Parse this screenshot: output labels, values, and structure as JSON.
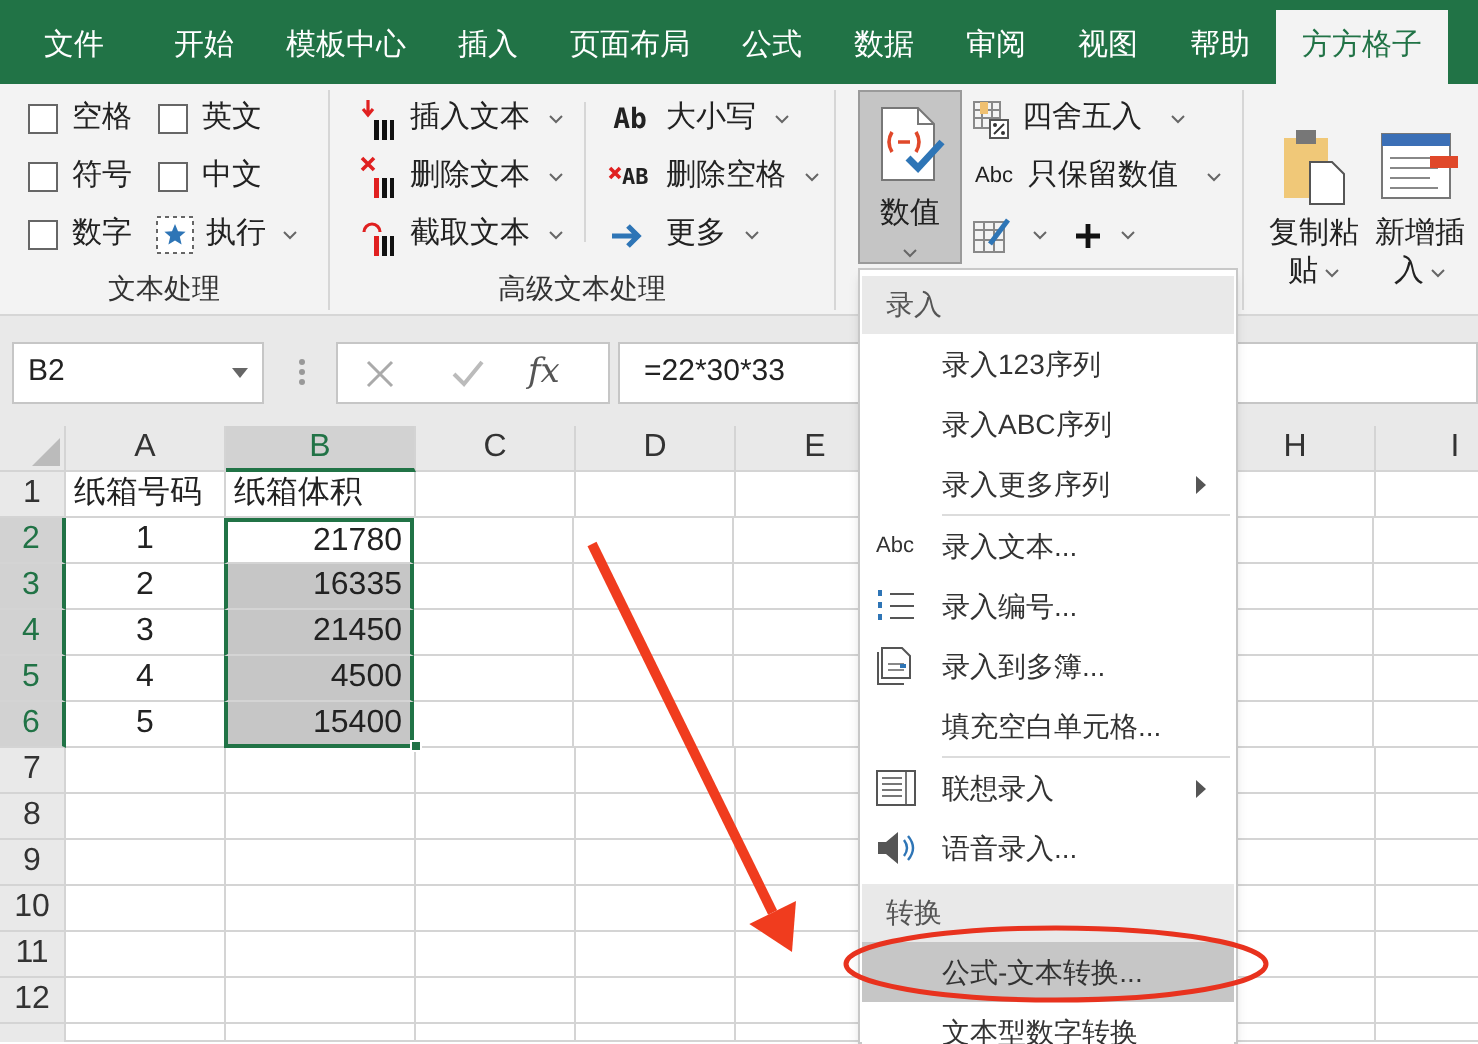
{
  "tabs": [
    {
      "label": "文件",
      "selected": false
    },
    {
      "label": "开始",
      "selected": false
    },
    {
      "label": "模板中心",
      "selected": false
    },
    {
      "label": "插入",
      "selected": false
    },
    {
      "label": "页面布局",
      "selected": false
    },
    {
      "label": "公式",
      "selected": false
    },
    {
      "label": "数据",
      "selected": false
    },
    {
      "label": "审阅",
      "selected": false
    },
    {
      "label": "视图",
      "selected": false
    },
    {
      "label": "帮助",
      "selected": false
    },
    {
      "label": "方方格子",
      "selected": true
    }
  ],
  "ribbon": {
    "text_group": {
      "label": "文本处理",
      "checkboxes": [
        {
          "label": "空格",
          "checked": false
        },
        {
          "label": "英文",
          "checked": false
        },
        {
          "label": "符号",
          "checked": false
        },
        {
          "label": "中文",
          "checked": false
        },
        {
          "label": "数字",
          "checked": false
        }
      ],
      "run_button": {
        "label": "执行"
      }
    },
    "advanced_group": {
      "label": "高级文本处理",
      "buttons": [
        {
          "kind": "insert-text",
          "label": "插入文本"
        },
        {
          "kind": "delete-text",
          "label": "删除文本"
        },
        {
          "kind": "extract-text",
          "label": "截取文本"
        },
        {
          "kind": "case",
          "label": "大小写",
          "icon_text": "Ab"
        },
        {
          "kind": "delete-spaces",
          "label": "删除空格",
          "icon_text": "AB"
        },
        {
          "kind": "more",
          "label": "更多"
        }
      ]
    },
    "number_group": {
      "main_button": {
        "label": "数值",
        "pressed": true
      },
      "buttons": [
        {
          "kind": "round",
          "label": "四舍五入"
        },
        {
          "kind": "values-only",
          "label": "只保留数值",
          "icon_text": "Abc"
        },
        {
          "kind": "edit"
        },
        {
          "kind": "plus"
        }
      ]
    },
    "clipboard_group": {
      "buttons": [
        {
          "kind": "paste",
          "label": "复制粘贴"
        },
        {
          "kind": "new-insert",
          "label": "新增插入"
        }
      ]
    }
  },
  "formula_bar": {
    "name_box": "B2",
    "function_label": "fx",
    "formula": "=22*30*33"
  },
  "sheet": {
    "columns": [
      {
        "label": "A",
        "selected": false
      },
      {
        "label": "B",
        "selected": true
      },
      {
        "label": "C",
        "selected": false
      },
      {
        "label": "D",
        "selected": false
      },
      {
        "label": "E",
        "selected": false
      },
      {
        "label": "H",
        "selected": false
      },
      {
        "label": "I",
        "selected": false
      }
    ],
    "rows": [
      {
        "header": "1",
        "selected": false,
        "cells": [
          {
            "text": "纸箱号码",
            "selected": false
          },
          {
            "text": "纸箱体积",
            "selected": false
          }
        ]
      },
      {
        "header": "2",
        "selected": true,
        "cells": [
          {
            "text": "1",
            "selected": false
          },
          {
            "text": "21780",
            "selected": true
          }
        ]
      },
      {
        "header": "3",
        "selected": true,
        "cells": [
          {
            "text": "2",
            "selected": false
          },
          {
            "text": "16335",
            "selected": true
          }
        ]
      },
      {
        "header": "4",
        "selected": true,
        "cells": [
          {
            "text": "3",
            "selected": false
          },
          {
            "text": "21450",
            "selected": true
          }
        ]
      },
      {
        "header": "5",
        "selected": true,
        "cells": [
          {
            "text": "4",
            "selected": false
          },
          {
            "text": "4500",
            "selected": true
          }
        ]
      },
      {
        "header": "6",
        "selected": true,
        "cells": [
          {
            "text": "5",
            "selected": false
          },
          {
            "text": "15400",
            "selected": true
          }
        ]
      },
      {
        "header": "7",
        "selected": false
      },
      {
        "header": "8",
        "selected": false
      },
      {
        "header": "9",
        "selected": false
      },
      {
        "header": "10",
        "selected": false
      },
      {
        "header": "11",
        "selected": false
      },
      {
        "header": "12",
        "selected": false
      }
    ]
  },
  "menu": {
    "sections": [
      {
        "title": "录入",
        "items": [
          {
            "label": "录入123序列",
            "submenu": false,
            "selected": false
          },
          {
            "label": "录入ABC序列",
            "submenu": false,
            "selected": false
          },
          {
            "label": "录入更多序列",
            "submenu": true,
            "selected": false
          },
          {
            "kind": "separator"
          },
          {
            "label": "录入文本...",
            "kind": "text",
            "icon_text": "Abc",
            "submenu": false,
            "selected": false
          },
          {
            "label": "录入编号...",
            "kind": "numbered-list",
            "submenu": false,
            "selected": false
          },
          {
            "label": "录入到多簿...",
            "kind": "sheets",
            "submenu": false,
            "selected": false
          },
          {
            "label": "填充空白单元格...",
            "submenu": false,
            "selected": false
          },
          {
            "kind": "separator"
          },
          {
            "label": "联想录入",
            "kind": "list-box",
            "submenu": true,
            "selected": false
          },
          {
            "label": "语音录入...",
            "kind": "speaker",
            "submenu": false,
            "selected": false
          }
        ]
      },
      {
        "title": "转换",
        "items": [
          {
            "label": "公式-文本转换...",
            "submenu": false,
            "selected": true
          },
          {
            "label": "文本型数字转换",
            "submenu": false,
            "selected": false
          }
        ]
      }
    ]
  },
  "annotations": [
    {
      "kind": "arrow"
    },
    {
      "kind": "ellipse"
    }
  ]
}
